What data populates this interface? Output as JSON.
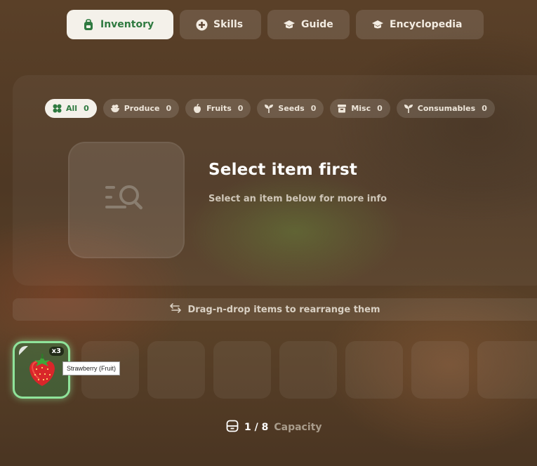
{
  "tabs": [
    {
      "label": "Inventory",
      "icon": "backpack-icon",
      "active": true
    },
    {
      "label": "Skills",
      "icon": "plus-circle-icon",
      "active": false
    },
    {
      "label": "Guide",
      "icon": "graduation-cap-icon",
      "active": false
    },
    {
      "label": "Encyclopedia",
      "icon": "graduation-cap-icon",
      "active": false
    }
  ],
  "filters": [
    {
      "label": "All",
      "count": "0",
      "icon": "clover-icon",
      "active": true
    },
    {
      "label": "Produce",
      "count": "0",
      "icon": "bowl-icon",
      "active": false
    },
    {
      "label": "Fruits",
      "count": "0",
      "icon": "apple-icon",
      "active": false
    },
    {
      "label": "Seeds",
      "count": "0",
      "icon": "sprout-icon",
      "active": false
    },
    {
      "label": "Misc",
      "count": "0",
      "icon": "box-icon",
      "active": false
    },
    {
      "label": "Consumables",
      "count": "0",
      "icon": "sprout-icon",
      "active": false
    }
  ],
  "detail": {
    "title": "Select item first",
    "subtitle": "Select an item below for more info"
  },
  "hint": {
    "text": "Drag-n-drop items to rearrange them",
    "icon": "swap-arrows-icon"
  },
  "slots": [
    {
      "item": "strawberry",
      "quantity": "x3",
      "tooltip": "Strawberry (Fruit)"
    }
  ],
  "capacity": {
    "value": "1 / 8",
    "label": "Capacity"
  },
  "colors": {
    "accent": "#2f7a40",
    "slot_border": "#8fe39a",
    "active_bg": "#f4f1ea"
  }
}
